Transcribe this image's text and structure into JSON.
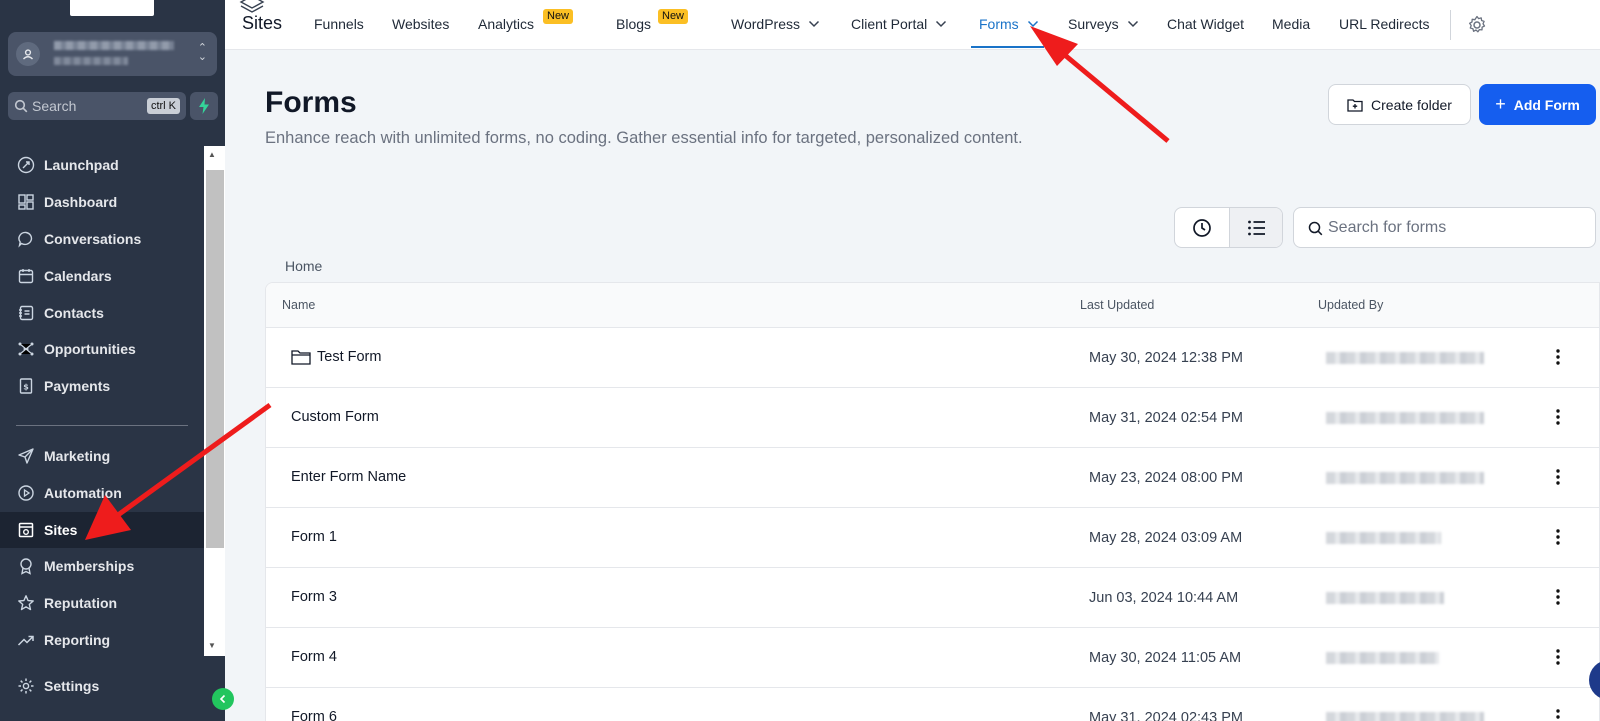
{
  "sidebar": {
    "search_placeholder": "Search",
    "search_shortcut": "ctrl K",
    "items": [
      {
        "label": "Launchpad",
        "icon": "rocket-icon"
      },
      {
        "label": "Dashboard",
        "icon": "dashboard-icon"
      },
      {
        "label": "Conversations",
        "icon": "chat-icon"
      },
      {
        "label": "Calendars",
        "icon": "calendar-icon"
      },
      {
        "label": "Contacts",
        "icon": "contacts-icon"
      },
      {
        "label": "Opportunities",
        "icon": "opportunities-icon"
      },
      {
        "label": "Payments",
        "icon": "payments-icon"
      },
      {
        "label": "Marketing",
        "icon": "send-icon"
      },
      {
        "label": "Automation",
        "icon": "automation-icon"
      },
      {
        "label": "Sites",
        "icon": "sites-icon"
      },
      {
        "label": "Memberships",
        "icon": "badge-icon"
      },
      {
        "label": "Reputation",
        "icon": "star-icon"
      },
      {
        "label": "Reporting",
        "icon": "trend-icon"
      },
      {
        "label": "Settings",
        "icon": "gear-icon"
      }
    ],
    "active_item": "Sites"
  },
  "topnav": {
    "title": "Sites",
    "tabs": [
      {
        "label": "Funnels"
      },
      {
        "label": "Websites"
      },
      {
        "label": "Analytics",
        "badge": "New"
      },
      {
        "label": "Blogs",
        "badge": "New"
      },
      {
        "label": "WordPress",
        "dropdown": true
      },
      {
        "label": "Client Portal",
        "dropdown": true
      },
      {
        "label": "Forms",
        "dropdown": true
      },
      {
        "label": "Surveys",
        "dropdown": true
      },
      {
        "label": "Chat Widget"
      },
      {
        "label": "Media"
      },
      {
        "label": "URL Redirects"
      }
    ],
    "active_tab": "Forms"
  },
  "main": {
    "title": "Forms",
    "description": "Enhance reach with unlimited forms, no coding. Gather essential info for targeted, personalized content.",
    "create_folder_label": "Create folder",
    "add_form_label": "Add Form",
    "search_placeholder": "Search for forms",
    "breadcrumb": "Home",
    "table": {
      "columns": [
        "Name",
        "Last Updated",
        "Updated By"
      ],
      "rows": [
        {
          "name": "Test Form",
          "is_folder": true,
          "updated": "May 30, 2024 12:38 PM"
        },
        {
          "name": "Custom Form",
          "is_folder": false,
          "updated": "May 31, 2024 02:54 PM"
        },
        {
          "name": "Enter Form Name",
          "is_folder": false,
          "updated": "May 23, 2024 08:00 PM"
        },
        {
          "name": "Form 1",
          "is_folder": false,
          "updated": "May 28, 2024 03:09 AM"
        },
        {
          "name": "Form 3",
          "is_folder": false,
          "updated": "Jun 03, 2024 10:44 AM"
        },
        {
          "name": "Form 4",
          "is_folder": false,
          "updated": "May 30, 2024 11:05 AM"
        },
        {
          "name": "Form 6",
          "is_folder": false,
          "updated": "May 31, 2024 02:43 PM"
        }
      ]
    }
  },
  "colors": {
    "sidebar_bg": "#2a3445",
    "accent": "#155eef",
    "active_tab": "#1a73c8",
    "badge": "#fbbf24",
    "annotation_arrow": "#ee1c1c"
  }
}
